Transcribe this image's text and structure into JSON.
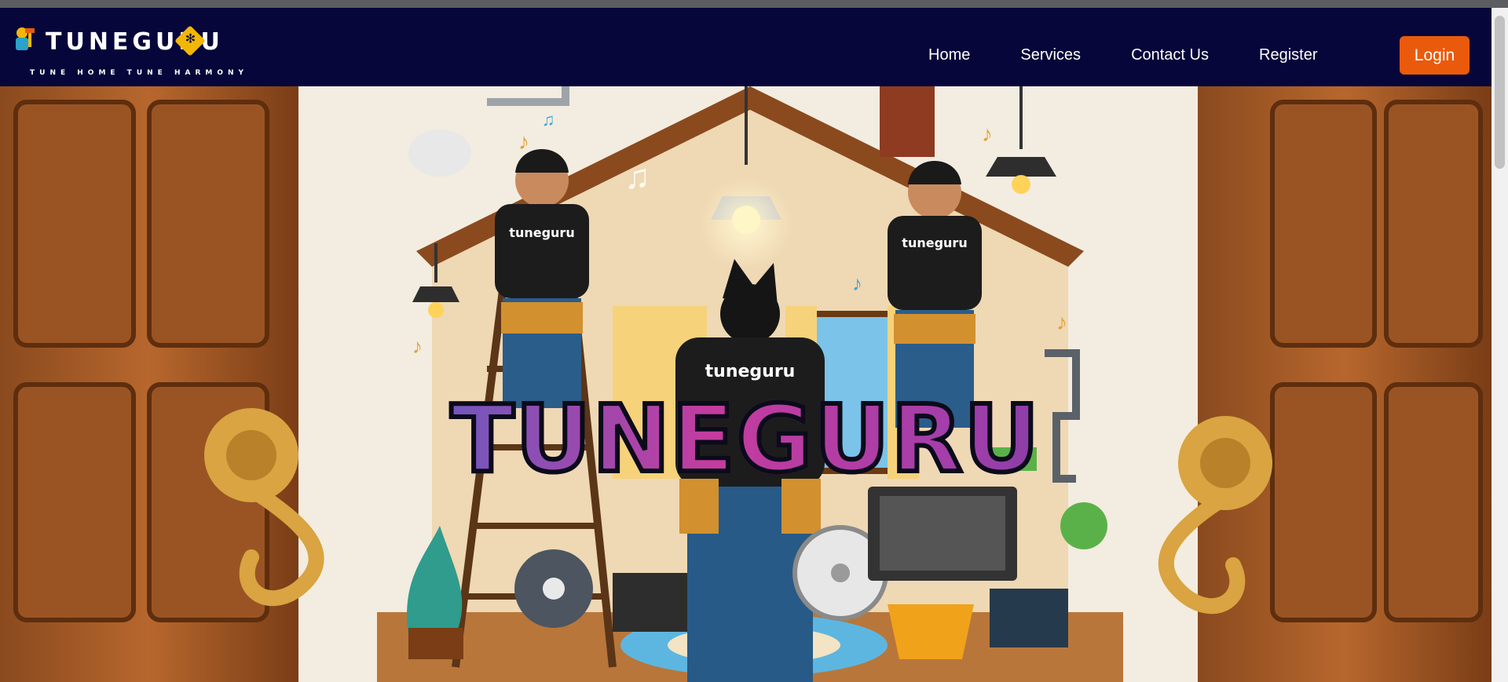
{
  "brand": {
    "name": "TUNEGURU",
    "tagline": "TUNE HOME TUNE HARMONY"
  },
  "nav": {
    "items": [
      {
        "label": "Home"
      },
      {
        "label": "Services"
      },
      {
        "label": "Contact Us"
      },
      {
        "label": "Register"
      }
    ],
    "login_label": "Login"
  },
  "hero": {
    "title": "TUNEGURU",
    "shirt_text": "tuneguru",
    "description": ""
  },
  "colors": {
    "navbar": "#06063a",
    "login": "#ea5a0c",
    "accent_yellow": "#f2b705"
  }
}
